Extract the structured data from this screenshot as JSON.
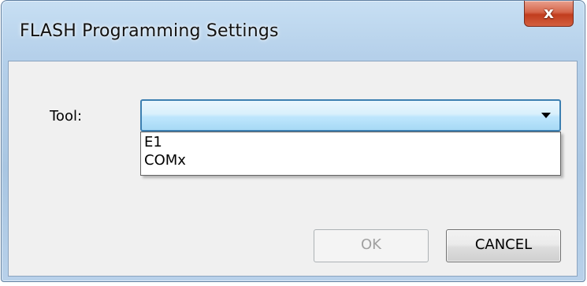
{
  "window": {
    "title": "FLASH Programming Settings",
    "close_glyph": "x"
  },
  "form": {
    "tool_label": "Tool:",
    "tool_value": "",
    "tool_options": [
      "E1",
      "COMx"
    ]
  },
  "buttons": {
    "ok_label": "OK",
    "ok_enabled": false,
    "cancel_label": "CANCEL"
  },
  "icons": {
    "close": "close-icon",
    "dropdown_arrow": "chevron-down-icon"
  },
  "colors": {
    "titlebar": "#b5d0ea",
    "close_button": "#c13d1e",
    "combo_focus_border": "#3c7fb1",
    "client_background": "#f0f0f0"
  }
}
